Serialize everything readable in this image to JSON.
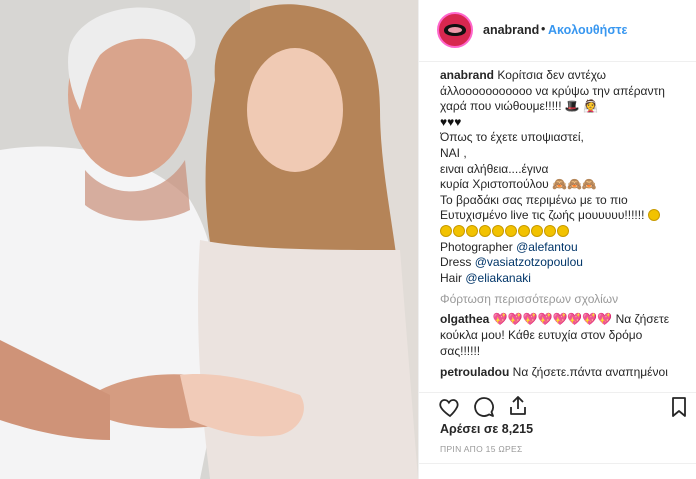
{
  "post": {
    "username": "anabrand",
    "separator": "•",
    "follow_label": "Ακολουθήστε"
  },
  "caption": {
    "author": "anabrand",
    "line1": "Κορίτσια δεν αντέχω άλλοοοοοοοοοοο να κρύψω την απέραντη χαρά που νιώθουμε!!!!!",
    "line2_hearts": "♥♥♥",
    "line3": "Όπως το έχετε υποψιαστεί,",
    "line4": "ΝΑΙ ,",
    "line5": "ειναι αλήθεια....έγινα",
    "line6": "κυρία Χριστοπούλου",
    "line7": "Το βραδάκι σας περιμένω με το πιο Ευτυχισμένο live τις ζωής μουυυυυ!!!!!!",
    "photographer_label": "Photographer",
    "photographer": "@alefantou",
    "dress_label": "Dress",
    "dress": "@vasiatzotzopoulou",
    "hair_label": "Hair",
    "hair": "@eliakanaki"
  },
  "load_more": "Φόρτωση περισσότερων σχολίων",
  "comments": [
    {
      "user": "olgathea",
      "hearts": "💖💖💖💖💖💖💖💖",
      "text": "Να ζήσετε κούκλα μου! Κάθε ευτυχία στον δρόμο σας!!!!!!"
    },
    {
      "user": "petrouladou",
      "text": "Να ζήσετε.πάντα αναπημένοι"
    }
  ],
  "icons": [
    "heart-icon",
    "comment-icon",
    "share-icon",
    "bookmark-icon"
  ],
  "likes": "Αρέσει σε 8,215",
  "timestamp": "ΠΡΙΝ ΑΠΟ 15 ΩΡΕΣ",
  "colors": {
    "follow": "#3897f0",
    "mention": "#003569",
    "muted": "#999999"
  }
}
